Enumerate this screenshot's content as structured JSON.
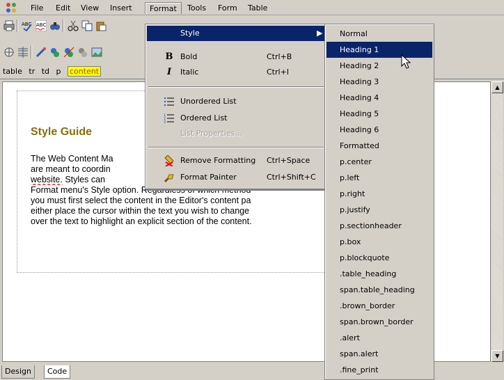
{
  "menubar": {
    "items": [
      "File",
      "Edit",
      "View",
      "Insert",
      "Format",
      "Tools",
      "Form",
      "Table"
    ],
    "active": "Format"
  },
  "tagbar": {
    "tags": [
      "table",
      "tr",
      "td",
      "p"
    ],
    "active_tag": "content"
  },
  "editor": {
    "heading": "Style Guide",
    "heading_color": "#8b6e0a",
    "lines": [
      "The Web Content Ma",
      "are meant to coordin",
      "website.",
      "Styles can",
      "Format menu's Style option.  Regardless of which method",
      "you must first select the content in the Editor's content pa",
      "either place the cursor within the text you wish to change",
      "over the text to highlight an explicit section of the content."
    ]
  },
  "format_menu": {
    "items": [
      {
        "label": "Style",
        "shortcut": "",
        "icon": "",
        "highlight": true,
        "submenu": true
      },
      {
        "label": "Bold",
        "shortcut": "Ctrl+B",
        "icon": "bold-icon"
      },
      {
        "label": "Italic",
        "shortcut": "Ctrl+I",
        "icon": "italic-icon"
      },
      {
        "label": "Unordered List",
        "shortcut": "",
        "icon": "unordered-list-icon"
      },
      {
        "label": "Ordered List",
        "shortcut": "",
        "icon": "ordered-list-icon"
      },
      {
        "label": "List Properties...",
        "shortcut": "",
        "icon": "",
        "disabled": true
      },
      {
        "label": "Remove Formatting",
        "shortcut": "Ctrl+Space",
        "icon": "remove-formatting-icon"
      },
      {
        "label": "Format Painter",
        "shortcut": "Ctrl+Shift+C",
        "icon": "format-painter-icon"
      }
    ]
  },
  "style_submenu": {
    "items": [
      "Normal",
      "Heading 1",
      "Heading 2",
      "Heading 3",
      "Heading 4",
      "Heading 5",
      "Heading 6",
      "Formatted",
      "p.center",
      "p.left",
      "p.right",
      "p.justify",
      "p.sectionheader",
      "p.box",
      "p.blockquote",
      ".table_heading",
      "span.table_heading",
      ".brown_border",
      "span.brown_border",
      ".alert",
      "span.alert",
      ".fine_print"
    ],
    "highlighted": "Heading 1"
  },
  "tabs": {
    "items": [
      "Design",
      "Code"
    ],
    "selected": "Design"
  },
  "colors": {
    "menu_highlight": "#0a246a",
    "chrome": "#d4d0c8",
    "tag_highlight": "#ffff00"
  }
}
